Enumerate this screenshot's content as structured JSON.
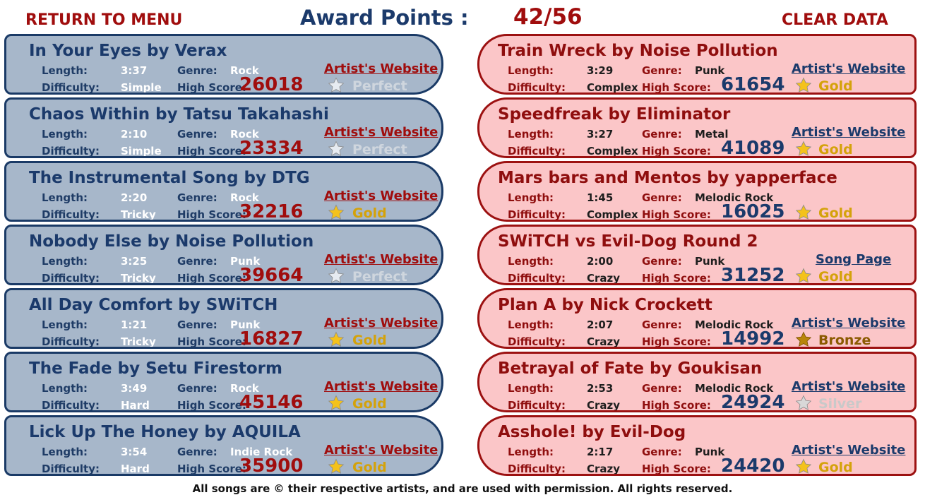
{
  "header": {
    "return_label": "RETURN TO MENU",
    "award_label": "Award Points :",
    "award_value": "42/56",
    "clear_label": "CLEAR DATA"
  },
  "labels": {
    "length": "Length:",
    "difficulty": "Difficulty:",
    "genre": "Genre:",
    "high_score": "High Score:"
  },
  "colors": {
    "gold": "#f4c21b",
    "silver": "#d8d8d8",
    "bronze": "#b8860b",
    "perfect": "#e6ebf1"
  },
  "left_songs": [
    {
      "title": "In Your Eyes by Verax",
      "length": "3:37",
      "genre": "Rock",
      "difficulty": "Simple",
      "score": "26018",
      "medal": "Perfect",
      "medal_type": "perfect",
      "link": "Artist's Website"
    },
    {
      "title": "Chaos Within by Tatsu Takahashi",
      "length": "2:10",
      "genre": "Rock",
      "difficulty": "Simple",
      "score": "23334",
      "medal": "Perfect",
      "medal_type": "perfect",
      "link": "Artist's Website"
    },
    {
      "title": "The Instrumental Song by DTG",
      "length": "2:20",
      "genre": "Rock",
      "difficulty": "Tricky",
      "score": "32216",
      "medal": "Gold",
      "medal_type": "gold",
      "link": "Artist's Website"
    },
    {
      "title": "Nobody Else by Noise Pollution",
      "length": "3:25",
      "genre": "Punk",
      "difficulty": "Tricky",
      "score": "39664",
      "medal": "Perfect",
      "medal_type": "perfect",
      "link": "Artist's Website"
    },
    {
      "title": "All Day Comfort by SWiTCH",
      "length": "1:21",
      "genre": "Punk",
      "difficulty": "Tricky",
      "score": "16827",
      "medal": "Gold",
      "medal_type": "gold",
      "link": "Artist's Website"
    },
    {
      "title": "The Fade by Setu Firestorm",
      "length": "3:49",
      "genre": "Rock",
      "difficulty": "Hard",
      "score": "45146",
      "medal": "Gold",
      "medal_type": "gold",
      "link": "Artist's Website"
    },
    {
      "title": "Lick Up The Honey by AQUILA",
      "length": "3:54",
      "genre": "Indie Rock",
      "difficulty": "Hard",
      "score": "35900",
      "medal": "Gold",
      "medal_type": "gold",
      "link": "Artist's Website"
    }
  ],
  "right_songs": [
    {
      "title": "Train Wreck by Noise Pollution",
      "length": "3:29",
      "genre": "Punk",
      "difficulty": "Complex",
      "score": "61654",
      "medal": "Gold",
      "medal_type": "gold",
      "link": "Artist's Website"
    },
    {
      "title": "Speedfreak by Eliminator",
      "length": "3:27",
      "genre": "Metal",
      "difficulty": "Complex",
      "score": "41089",
      "medal": "Gold",
      "medal_type": "gold",
      "link": "Artist's Website"
    },
    {
      "title": "Mars bars and Mentos by yapperface",
      "length": "1:45",
      "genre": "Melodic Rock",
      "difficulty": "Complex",
      "score": "16025",
      "medal": "Gold",
      "medal_type": "gold",
      "link": ""
    },
    {
      "title": "SWiTCH vs Evil-Dog Round 2",
      "length": "2:00",
      "genre": "Punk",
      "difficulty": "Crazy",
      "score": "31252",
      "medal": "Gold",
      "medal_type": "gold",
      "link": "Song Page"
    },
    {
      "title": "Plan A by Nick Crockett",
      "length": "2:07",
      "genre": "Melodic Rock",
      "difficulty": "Crazy",
      "score": "14992",
      "medal": "Bronze",
      "medal_type": "bronze",
      "link": "Artist's Website"
    },
    {
      "title": "Betrayal of Fate by Goukisan",
      "length": "2:53",
      "genre": "Melodic Rock",
      "difficulty": "Crazy",
      "score": "24924",
      "medal": "Silver",
      "medal_type": "silver",
      "link": "Artist's Website"
    },
    {
      "title": "Asshole! by Evil-Dog",
      "length": "2:17",
      "genre": "Punk",
      "difficulty": "Crazy",
      "score": "24420",
      "medal": "Gold",
      "medal_type": "gold",
      "link": "Artist's Website"
    }
  ],
  "footer": "All songs are © their respective artists, and are used with permission. All rights reserved."
}
